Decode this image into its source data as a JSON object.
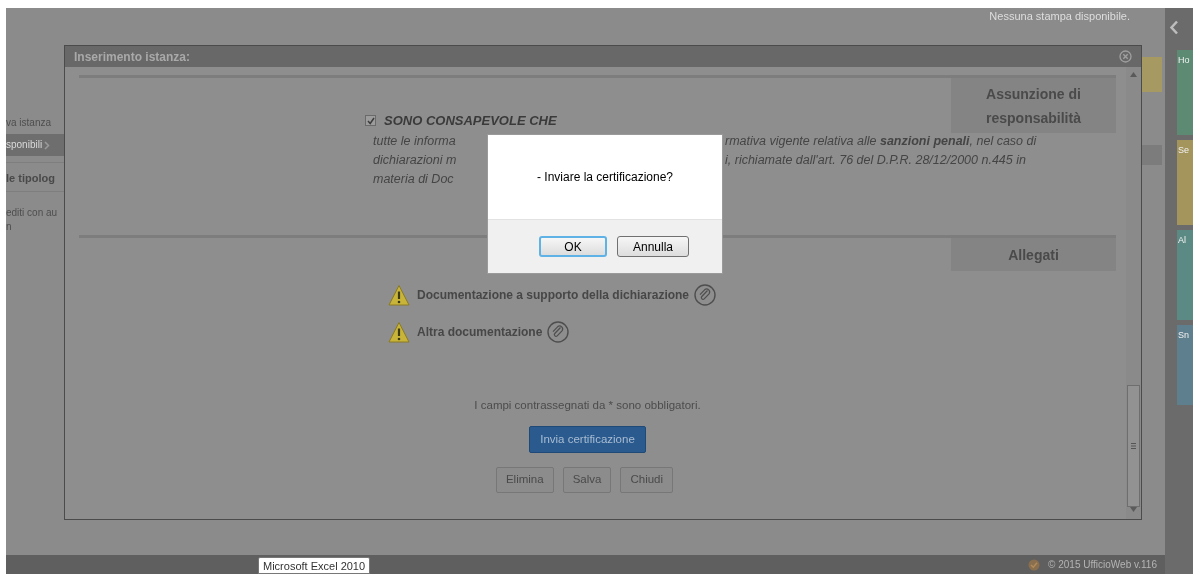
{
  "background_page": {
    "print_status": "Nessuna stampa disponibile.",
    "side_items": [
      {
        "label": "va istanza",
        "kind": "link"
      },
      {
        "label": "sponibili",
        "kind": "bar"
      },
      {
        "label": "le tipolog",
        "kind": "heading"
      },
      {
        "label": "editi con au",
        "kind": "link"
      },
      {
        "label": "n",
        "kind": "link"
      }
    ]
  },
  "right_panel": {
    "tiles": [
      {
        "label": "Ho",
        "color": "#5d8a73"
      },
      {
        "label": "Se",
        "color": "#a3955c"
      },
      {
        "label": "Al",
        "color": "#5b8a84"
      },
      {
        "label": "Sn",
        "color": "#5e7f8d"
      }
    ]
  },
  "modal": {
    "title": "Inserimento istanza:",
    "sections": [
      {
        "kind": "consent",
        "header": "Assunzione di responsabilità",
        "checked": true,
        "checkbox_label": "SONO CONSAPEVOLE CHE",
        "lines": [
          {
            "left": "tutte le informa",
            "right": "rmativa vigente relativa alle **sanzioni penali**, nel caso di"
          },
          {
            "left": "dichiarazioni m",
            "right": "i, richiamate dall'art. 76 del D.P.R. 28/12/2000 n.445 in"
          },
          {
            "left": "materia di Doc"
          }
        ]
      },
      {
        "kind": "attachments",
        "header": "Allegati",
        "items": [
          {
            "label": "Documentazione a supporto della dichiarazione"
          },
          {
            "label": "Altra documentazione"
          }
        ]
      }
    ],
    "required_note": "I campi contrassegnati da * sono obbligatori.",
    "primary_button": "Invia certificazione",
    "buttons": [
      "Elimina",
      "Salva",
      "Chiudi"
    ]
  },
  "confirm": {
    "message": "- Inviare la certificazione?",
    "buttons": [
      {
        "label": "OK",
        "selected": true
      },
      {
        "label": "Annulla",
        "selected": false
      }
    ]
  },
  "footer": {
    "copyright": "© 2015 UfficioWeb v.116"
  },
  "tooltip": {
    "text": "Microsoft Excel 2010"
  }
}
